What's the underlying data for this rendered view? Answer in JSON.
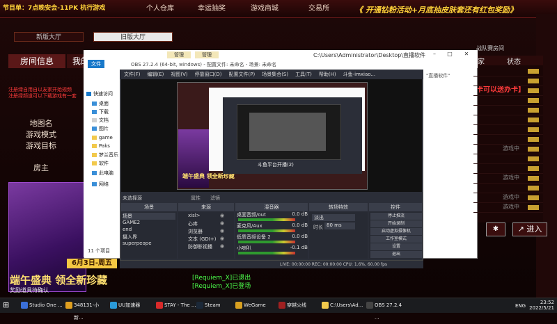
{
  "game": {
    "ticker": "节目单：7点晚安会-11PK 杭行游戏",
    "banner": "《 开通钻粉活动+月底抽皮肤套还有红包奖励》",
    "nav": [
      "个人仓库",
      "幸运抽奖",
      "游戏商城",
      "交易所"
    ],
    "lobby_new": "新版大厅",
    "lobby_old": "旧版大厅",
    "room_info": "房间信息",
    "room_info_2": "我的",
    "side_labels": [
      "地图名",
      "游戏模式",
      "游戏目标",
      "房主"
    ],
    "red_notice_1": "注册绿自用自以友家开始规频",
    "red_notice_2": "注册绿频道可以下载游戏有一套",
    "battle_label": "战队赛房间",
    "right_header": [
      "家",
      "状态"
    ],
    "right_rows": [
      "",
      "",
      "",
      "",
      "",
      "",
      "",
      "",
      "游戏中",
      "",
      "",
      "游戏中",
      "",
      "游戏中",
      "游戏中"
    ],
    "notice": "【今日双倍，打卡可以送办卡】",
    "enter": "进入",
    "chat_1": "[Requiem_X]已退出",
    "chat_2": "[Requiem_X]已登场",
    "poster": {
      "date": "6月3日-周五",
      "title": "端午盛典 领全新珍藏",
      "bottom": "奖励道具待确认"
    }
  },
  "explorer": {
    "path": "C:\\Users\\Administrator\\Desktop\\直播软件",
    "tab_manage_1": "管理",
    "tab_manage_2": "管理",
    "file_tab": "文件",
    "nav_items": [
      {
        "label": "快速访问",
        "color": "#1979ca"
      },
      {
        "label": "桌面",
        "color": "#3a8fd8"
      },
      {
        "label": "下载",
        "color": "#3a8fd8"
      },
      {
        "label": "文档",
        "color": "#d0d0d0"
      },
      {
        "label": "图片",
        "color": "#3a8fd8"
      },
      {
        "label": "game",
        "color": "#f2c94c"
      },
      {
        "label": "Paks",
        "color": "#f2c94c"
      },
      {
        "label": "梦兰音乐",
        "color": "#f2c94c"
      },
      {
        "label": "软件",
        "color": "#f2c94c"
      },
      {
        "label": "此电脑",
        "color": "#3a8fd8"
      },
      {
        "label": "网络",
        "color": "#3a8fd8"
      }
    ],
    "status": "11 个项目",
    "search_hint": "直播软件"
  },
  "obs": {
    "title": "OBS 27.2.4 (64-bit, windows) - 配置文件: 未命名 - 场景: 未命名",
    "menu": [
      "文件(F)",
      "编辑(E)",
      "视图(V)",
      "停靠窗口(D)",
      "配置文件(P)",
      "场景集合(S)",
      "工具(T)",
      "帮助(H)",
      "斗鱼-imxiao..."
    ],
    "no_source": "未选择源",
    "filter_btn": "属性",
    "mirror_btn": "滤镜",
    "canvas_banner": "端午盛典 领全新珍藏",
    "inner_label": "斗鱼平台开播(2)",
    "dock_titles": [
      "场景",
      "来源",
      "混音器",
      "转场特效",
      "控件"
    ],
    "scenes": [
      "场景",
      "GAME2",
      "end",
      "摄入界",
      "superpeope"
    ],
    "sources": [
      "xisl>",
      "心疼",
      "浏览器",
      "文本 (GDI+)",
      "防御影视播"
    ],
    "mixer": [
      {
        "name": "桌面音频/out",
        "db": "0.0 dB"
      },
      {
        "name": "麦克风/Aux",
        "db": "0.0 dB"
      },
      {
        "name": "低质音频设备 2",
        "db": "0.0 dB"
      },
      {
        "name": "小喇叭",
        "db": "-0.1 dB"
      }
    ],
    "transition": "淡出",
    "duration_label": "时长",
    "duration_value": "80 ms",
    "controls": [
      "停止推流",
      "开始录制",
      "启动虚拟摄像机",
      "工作室模式",
      "设置",
      "退出"
    ],
    "status": "LIVE: 00:00:00   REC: 00:00:00   CPU: 1.6%, 60.00 fps"
  },
  "taskbar": {
    "items": [
      {
        "label": "Studio One ...",
        "color": "#3a6fd8"
      },
      {
        "label": "348131-小新...",
        "color": "#e0a020"
      },
      {
        "label": "UU加速器",
        "color": "#2a9ad8"
      },
      {
        "label": "STAY - The ...",
        "color": "#d82a2a"
      },
      {
        "label": "Steam",
        "color": "#1b2838"
      },
      {
        "label": "WeGame",
        "color": "#d8a020"
      },
      {
        "label": "穿越火线",
        "color": "#a02020"
      },
      {
        "label": "C:\\Users\\Ad...",
        "color": "#f2c94c"
      },
      {
        "label": "OBS 27.2.4 ...",
        "color": "#444444"
      }
    ],
    "time": "23:52",
    "date": "2022/5/21",
    "lang": "ENG"
  }
}
